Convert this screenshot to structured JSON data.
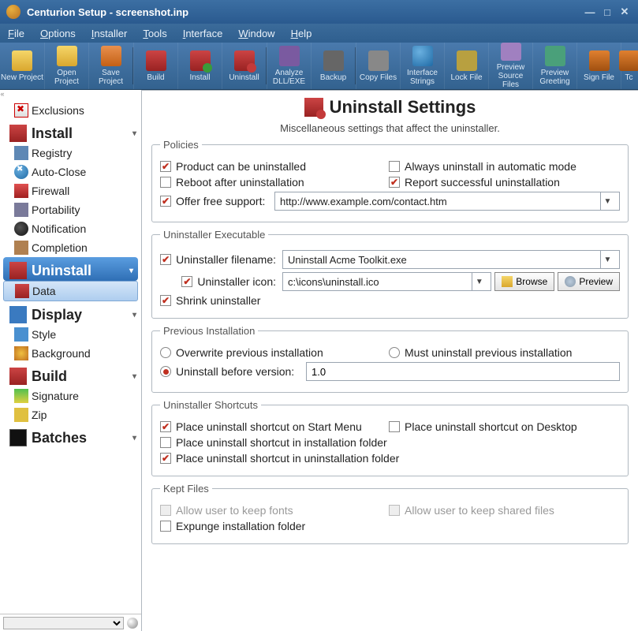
{
  "window": {
    "title": "Centurion Setup - screenshot.inp"
  },
  "menu": {
    "file": "File",
    "options": "Options",
    "installer": "Installer",
    "tools": "Tools",
    "interface": "Interface",
    "window": "Window",
    "help": "Help"
  },
  "toolbar": [
    {
      "label": "New\nProject"
    },
    {
      "label": "Open\nProject"
    },
    {
      "label": "Save\nProject"
    },
    {
      "sep": true
    },
    {
      "label": "Build"
    },
    {
      "label": "Install"
    },
    {
      "label": "Uninstall"
    },
    {
      "sep": true
    },
    {
      "label": "Analyze\nDLL/EXE"
    },
    {
      "label": "Backup"
    },
    {
      "sep": true
    },
    {
      "label": "Copy\nFiles"
    },
    {
      "label": "Interface\nStrings"
    },
    {
      "label": "Lock\nFile"
    },
    {
      "label": "Preview\nSource Files"
    },
    {
      "label": "Preview\nGreeting"
    },
    {
      "label": "Sign\nFile"
    },
    {
      "label": "Tc"
    }
  ],
  "sidebar": {
    "items": [
      {
        "label": "Exclusions",
        "type": "item",
        "icon": "exclusions"
      },
      {
        "label": "Install",
        "type": "head",
        "icon": "install"
      },
      {
        "label": "Registry",
        "type": "item",
        "icon": "registry"
      },
      {
        "label": "Auto-Close",
        "type": "item",
        "icon": "auto-close"
      },
      {
        "label": "Firewall",
        "type": "item",
        "icon": "firewall"
      },
      {
        "label": "Portability",
        "type": "item",
        "icon": "portability"
      },
      {
        "label": "Notification",
        "type": "item",
        "icon": "notification"
      },
      {
        "label": "Completion",
        "type": "item",
        "icon": "completion"
      },
      {
        "label": "Uninstall",
        "type": "head",
        "icon": "uninstall",
        "selected": true
      },
      {
        "label": "Data",
        "type": "item",
        "icon": "data",
        "selected": true
      },
      {
        "label": "Display",
        "type": "head",
        "icon": "display"
      },
      {
        "label": "Style",
        "type": "item",
        "icon": "style"
      },
      {
        "label": "Background",
        "type": "item",
        "icon": "background"
      },
      {
        "label": "Build",
        "type": "head",
        "icon": "build"
      },
      {
        "label": "Signature",
        "type": "item",
        "icon": "signature"
      },
      {
        "label": "Zip",
        "type": "item",
        "icon": "zip"
      },
      {
        "label": "Batches",
        "type": "head",
        "icon": "batches"
      }
    ]
  },
  "page": {
    "title": "Uninstall Settings",
    "subtitle": "Miscellaneous settings that affect the uninstaller."
  },
  "policies": {
    "legend": "Policies",
    "can_uninstall": {
      "label": "Product can be uninstalled",
      "checked": true
    },
    "auto_mode": {
      "label": "Always uninstall in automatic mode",
      "checked": false
    },
    "reboot": {
      "label": "Reboot after uninstallation",
      "checked": false
    },
    "report": {
      "label": "Report successful uninstallation",
      "checked": true
    },
    "free_support": {
      "label": "Offer free support:",
      "checked": true,
      "value": "http://www.example.com/contact.htm"
    }
  },
  "exe": {
    "legend": "Uninstaller Executable",
    "filename": {
      "label": "Uninstaller filename:",
      "checked": true,
      "value": "Uninstall Acme Toolkit.exe"
    },
    "icon": {
      "label": "Uninstaller icon:",
      "checked": true,
      "value": "c:\\icons\\uninstall.ico",
      "browse": "Browse",
      "preview": "Preview"
    },
    "shrink": {
      "label": "Shrink uninstaller",
      "checked": true
    }
  },
  "prev": {
    "legend": "Previous Installation",
    "overwrite": {
      "label": "Overwrite previous installation",
      "checked": false
    },
    "must": {
      "label": "Must uninstall previous installation",
      "checked": false
    },
    "before": {
      "label": "Uninstall before version:",
      "checked": true,
      "value": "1.0"
    }
  },
  "shortcuts": {
    "legend": "Uninstaller Shortcuts",
    "start": {
      "label": "Place uninstall shortcut on Start Menu",
      "checked": true
    },
    "desktop": {
      "label": "Place uninstall shortcut on Desktop",
      "checked": false
    },
    "inst": {
      "label": "Place uninstall shortcut in installation folder",
      "checked": false
    },
    "uninst": {
      "label": "Place uninstall shortcut in uninstallation folder",
      "checked": true
    }
  },
  "kept": {
    "legend": "Kept Files",
    "fonts": {
      "label": "Allow user to keep fonts",
      "disabled": true
    },
    "shared": {
      "label": "Allow user to keep shared files",
      "disabled": true
    },
    "expunge": {
      "label": "Expunge installation folder",
      "checked": false
    }
  }
}
